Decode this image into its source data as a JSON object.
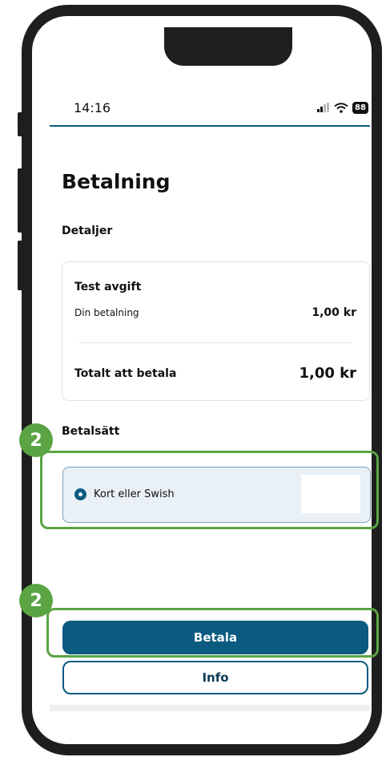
{
  "status_bar": {
    "time": "14:16",
    "battery": "88"
  },
  "page": {
    "title": "Betalning"
  },
  "details": {
    "heading": "Detaljer",
    "item_title": "Test avgift",
    "line_label": "Din betalning",
    "line_amount": "1,00 kr",
    "total_label": "Totalt att betala",
    "total_amount": "1,00 kr"
  },
  "payment_method": {
    "heading": "Betalsätt",
    "option_label": "Kort eller Swish",
    "selected": true
  },
  "buttons": {
    "pay": "Betala",
    "info": "Info"
  },
  "annotations": {
    "badge_1": "2",
    "badge_2": "2",
    "highlight_color": "#5aa443"
  },
  "colors": {
    "primary": "#0b5a80",
    "option_bg": "#e9f0f6"
  }
}
